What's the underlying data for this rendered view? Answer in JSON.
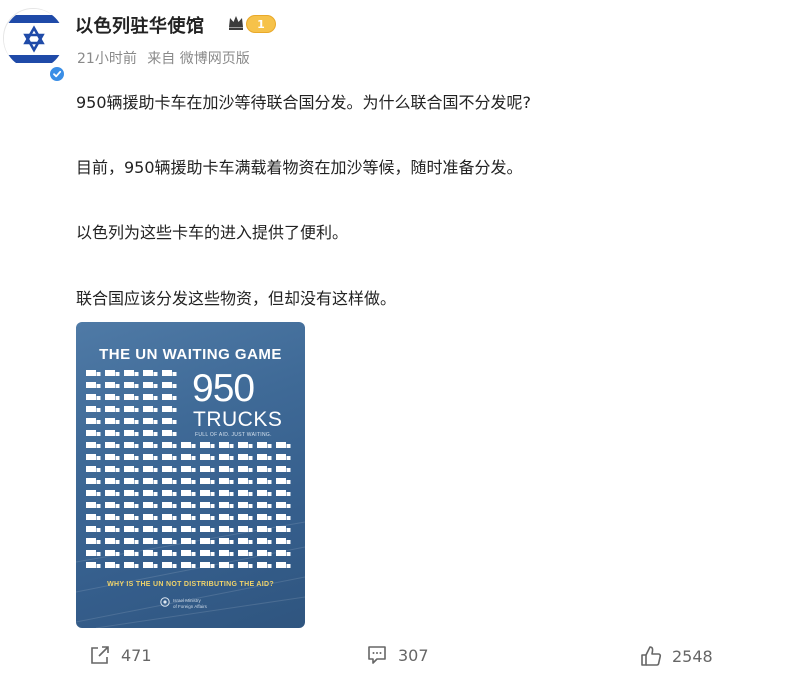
{
  "account": {
    "name": "以色列驻华使馆",
    "level_badge": "1",
    "avatar_icon": "israel-flag-icon",
    "verified_icon": "verified-check-icon"
  },
  "meta": {
    "time": "21小时前",
    "source": "来自 微博网页版"
  },
  "post": {
    "paragraphs": [
      "950辆援助卡车在加沙等待联合国分发。为什么联合国不分发呢?",
      "目前，950辆援助卡车满载着物资在加沙等候，随时准备分发。",
      "以色列为这些卡车的进入提供了便利。",
      "联合国应该分发这些物资，但却没有这样做。"
    ]
  },
  "poster": {
    "title": "THE UN WAITING GAME",
    "number": "950",
    "trucks_label": "TRUCKS",
    "subtitle": "FULL OF AID. JUST WAITING.",
    "bottom_text": "WHY IS THE UN NOT DISTRIBUTING THE AID?",
    "org_line1": "Israel Ministry",
    "org_line2": "of Foreign Affairs",
    "colors": {
      "background": "#3f6a97",
      "accent": "#f0d36a"
    }
  },
  "actions": {
    "share_count": "471",
    "comment_count": "307",
    "like_count": "2548",
    "share_icon": "share-arrow-icon",
    "comment_icon": "comment-bubble-icon",
    "like_icon": "thumbs-up-icon"
  }
}
